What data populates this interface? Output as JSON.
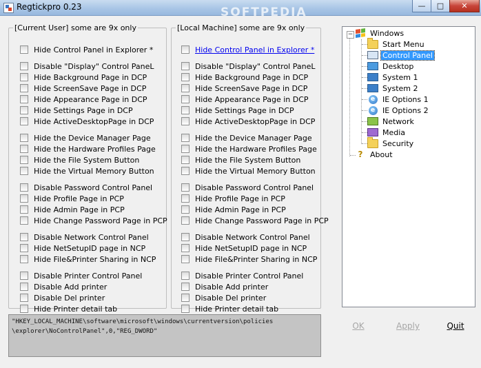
{
  "window": {
    "title": "Regtickpro 0.23",
    "watermark": "SOFTPEDIA",
    "minimize_glyph": "—",
    "maximize_glyph": "□",
    "close_glyph": "✕"
  },
  "current_user": {
    "legend": "[Current User] some are 9x only",
    "options": [
      {
        "label": "Hide Control Panel in Explorer *"
      },
      {
        "label": "Disable \"Display\" Control PaneL"
      },
      {
        "label": "Hide Background Page in DCP"
      },
      {
        "label": "Hide ScreenSave Page in DCP"
      },
      {
        "label": "Hide Appearance Page in DCP"
      },
      {
        "label": "Hide Settings Page in DCP"
      },
      {
        "label": "Hide ActiveDesktopPage in DCP"
      },
      {
        "label": "Hide the Device Manager Page"
      },
      {
        "label": "Hide the Hardware Profiles Page"
      },
      {
        "label": "Hide the File System Button"
      },
      {
        "label": "Hide the Virtual Memory Button"
      },
      {
        "label": "Disable Password Control Panel"
      },
      {
        "label": "Hide Profile Page in PCP"
      },
      {
        "label": "Hide Admin Page in PCP"
      },
      {
        "label": "Hide Change Password Page in PCP"
      },
      {
        "label": "Disable Network Control Panel"
      },
      {
        "label": "Hide NetSetupID page in NCP"
      },
      {
        "label": "Hide File&Printer Sharing  in NCP"
      },
      {
        "label": "Disable Printer Control Panel"
      },
      {
        "label": "Disable Add printer"
      },
      {
        "label": "Disable Del printer"
      },
      {
        "label": "Hide Printer detail tab"
      }
    ]
  },
  "local_machine": {
    "legend": "[Local Machine]  some are 9x only",
    "options": [
      {
        "label": "Hide Control Panel in Explorer *"
      },
      {
        "label": "Disable \"Display\" Control PaneL"
      },
      {
        "label": "Hide Background Page in DCP"
      },
      {
        "label": "Hide ScreenSave Page in DCP"
      },
      {
        "label": "Hide Appearance Page in DCP"
      },
      {
        "label": "Hide Settings Page in DCP"
      },
      {
        "label": "Hide ActiveDesktopPage in DCP"
      },
      {
        "label": "Hide the Device Manager Page"
      },
      {
        "label": "Hide the Hardware Profiles Page"
      },
      {
        "label": "Hide the File System Button"
      },
      {
        "label": "Hide the Virtual Memory Button"
      },
      {
        "label": "Disable Password Control Panel"
      },
      {
        "label": "Hide Profile Page in PCP"
      },
      {
        "label": "Hide Admin Page in PCP"
      },
      {
        "label": "Hide Change Password Page in PCP"
      },
      {
        "label": "Disable Network Control Panel"
      },
      {
        "label": "Hide NetSetupID page in NCP"
      },
      {
        "label": "Hide File&Printer Sharing  in NCP"
      },
      {
        "label": "Disable Printer Control Panel"
      },
      {
        "label": "Disable Add printer"
      },
      {
        "label": "Disable Del printer"
      },
      {
        "label": "Hide Printer detail tab"
      }
    ]
  },
  "tree": {
    "root": {
      "label": "Windows",
      "expander": "−"
    },
    "children": [
      {
        "label": "Start Menu",
        "icon": "folder-icon"
      },
      {
        "label": "Control Panel",
        "icon": "control-panel-icon",
        "selected": true
      },
      {
        "label": "Desktop",
        "icon": "desktop-icon"
      },
      {
        "label": "System 1",
        "icon": "computer-icon"
      },
      {
        "label": "System 2",
        "icon": "computer-icon"
      },
      {
        "label": "IE Options 1",
        "icon": "ie-icon"
      },
      {
        "label": "IE Options 2",
        "icon": "ie-icon"
      },
      {
        "label": "Network",
        "icon": "network-icon"
      },
      {
        "label": "Media",
        "icon": "media-icon"
      },
      {
        "label": "Security",
        "icon": "folder-icon"
      }
    ],
    "about": {
      "label": "About",
      "icon": "help-icon"
    }
  },
  "output": {
    "text": "\"HKEY_LOCAL_MACHINE\\software\\microsoft\\windows\\currentversion\\policies\n\\explorer\\NoControlPanel\",0,\"REG_DWORD\""
  },
  "buttons": {
    "ok": "OK",
    "apply": "Apply",
    "quit": "Quit"
  }
}
